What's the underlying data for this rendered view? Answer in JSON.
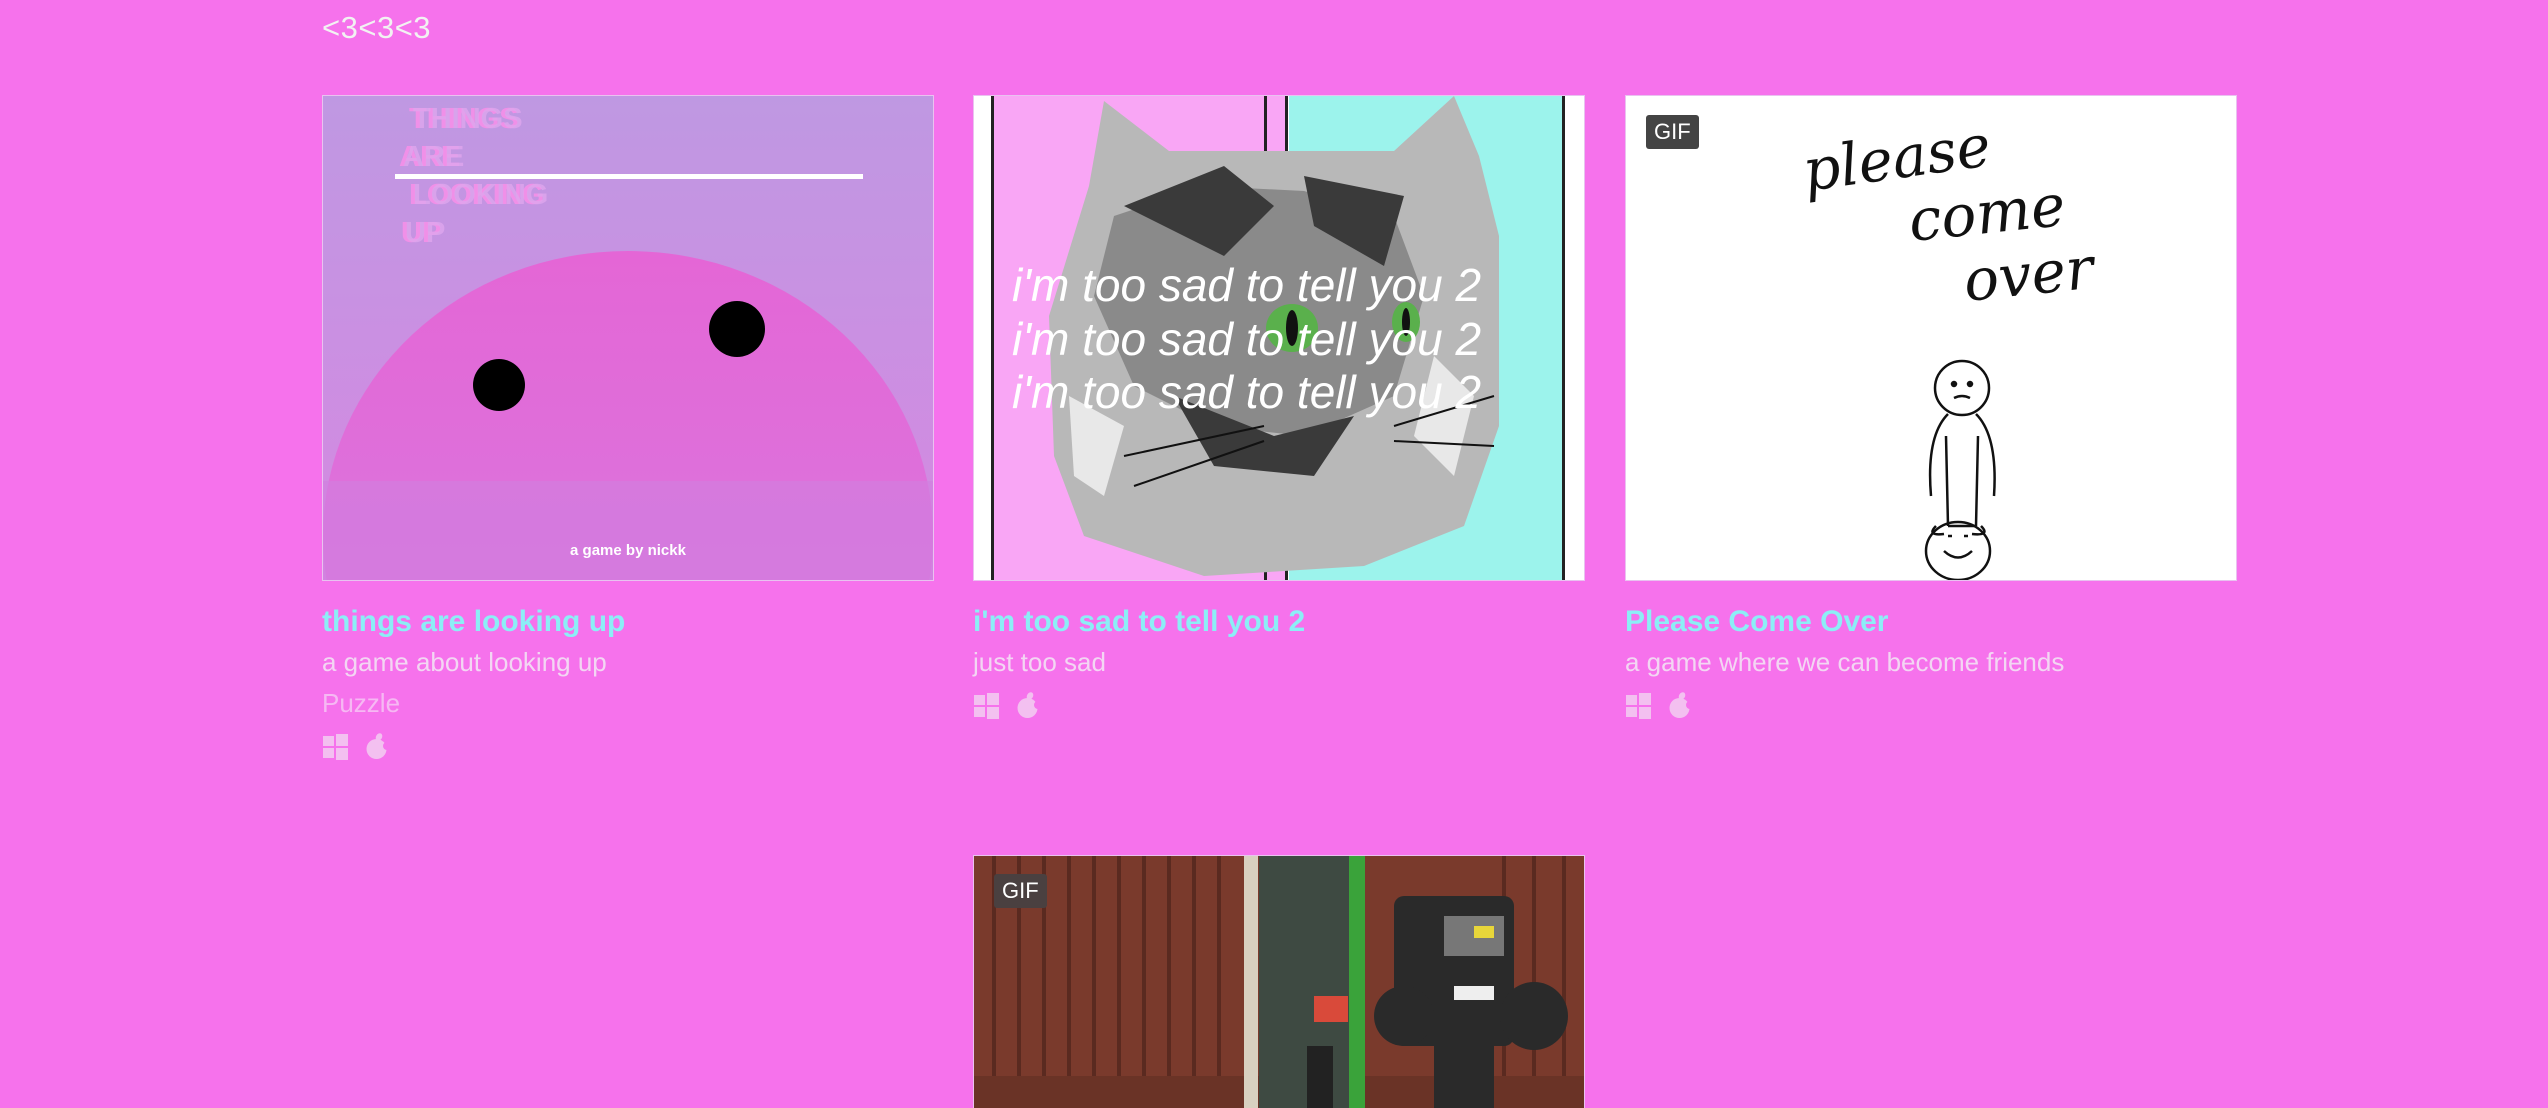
{
  "section": {
    "title": "<3<3<3"
  },
  "games": [
    {
      "title": "things are looking up",
      "description": "a game about looking up",
      "genre": "Puzzle",
      "platforms": [
        "windows-icon",
        "apple-icon"
      ],
      "thumbnail": {
        "title_lines": [
          "THINGS",
          "ARE",
          "LOOKING",
          "UP"
        ],
        "credit": "a game by nickk"
      }
    },
    {
      "title": "i'm too sad to tell you 2",
      "description": "just too sad",
      "platforms": [
        "windows-icon",
        "apple-icon"
      ],
      "thumbnail": {
        "caption": "i'm too sad to tell you 2"
      }
    },
    {
      "title": "Please Come Over",
      "description": "a game where we can become friends",
      "platforms": [
        "windows-icon",
        "apple-icon"
      ],
      "thumbnail": {
        "badge": "GIF",
        "handwritten": [
          "please",
          "come",
          "over"
        ]
      }
    },
    {
      "thumbnail": {
        "badge": "GIF"
      }
    }
  ],
  "colors": {
    "background": "#f672ec",
    "title_link": "#8ceef6",
    "description": "#f3d6f3",
    "genre": "#f6b8f3"
  }
}
